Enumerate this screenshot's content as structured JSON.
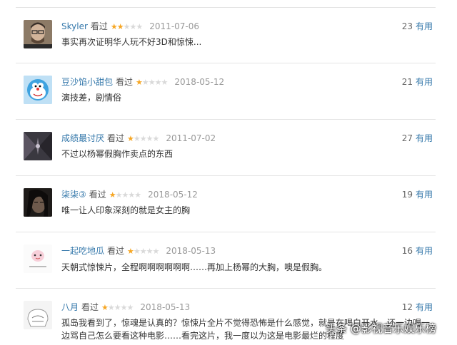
{
  "reviews": [
    {
      "user": "Skyler",
      "watched": "看过",
      "rating": 2,
      "date": "2011-07-06",
      "votes": "23",
      "useful": "有用",
      "text": "事实再次证明华人玩不好3D和惊悚..."
    },
    {
      "user": "豆沙馅小甜包",
      "watched": "看过",
      "rating": 1,
      "date": "2018-05-12",
      "votes": "21",
      "useful": "有用",
      "text": "演技差，剧情俗"
    },
    {
      "user": "成绩最讨厌",
      "watched": "看过",
      "rating": 1,
      "date": "2011-07-02",
      "votes": "27",
      "useful": "有用",
      "text": "不过以杨幂假胸作卖点的东西"
    },
    {
      "user": "柒柒③",
      "watched": "看过",
      "rating": 1,
      "date": "2018-05-12",
      "votes": "19",
      "useful": "有用",
      "text": "唯一让人印象深刻的就是女主的胸"
    },
    {
      "user": "一起吃地瓜",
      "watched": "看过",
      "rating": 1,
      "date": "2018-05-13",
      "votes": "16",
      "useful": "有用",
      "text": "天朝式惊悚片，全程啊啊啊啊啊啊……再加上杨幂的大胸，噢是假胸。"
    },
    {
      "user": "八月",
      "watched": "看过",
      "rating": 1,
      "date": "2018-05-13",
      "votes": "12",
      "useful": "有用",
      "text": "孤岛我看到了，惊魂是认真的？惊悚片全片不觉得恐怖是什么感觉，就是在喝白开水，还一边喝一边骂自己怎么要看这种电影……看完这片，我一度以为这是电影最烂的程度"
    }
  ],
  "watermark": "头条 @影视音乐娱乐榜",
  "star_colors": {
    "on": "#f6a623",
    "off": "#d9d9d9"
  },
  "link_color": "#3377aa"
}
